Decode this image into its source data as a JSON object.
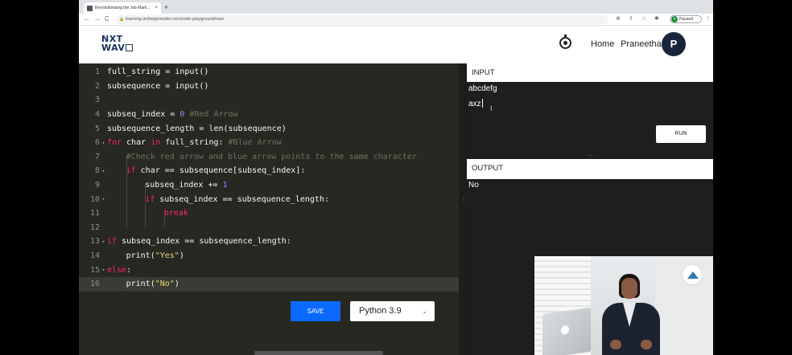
{
  "browser": {
    "tab_title": "Revolutionizing the Job Mark...",
    "tab_close": "×",
    "new_tab": "+",
    "nav_back": "←",
    "nav_forward": "→",
    "nav_reload": "C",
    "lock": "🔒",
    "url": "learning.onthegomodel.com/code-playground/new",
    "profile_initial": "V",
    "profile_status": "Paused"
  },
  "header": {
    "logo_line1": "NXT",
    "logo_line2": "WAV",
    "nav_home": "Home",
    "nav_user": "Praneetha",
    "avatar_initial": "P"
  },
  "editor": {
    "lines": [
      {
        "n": "1",
        "fold": "",
        "active": false
      },
      {
        "n": "2",
        "fold": "",
        "active": false
      },
      {
        "n": "3",
        "fold": "",
        "active": false
      },
      {
        "n": "4",
        "fold": "",
        "active": false
      },
      {
        "n": "5",
        "fold": "",
        "active": false
      },
      {
        "n": "6",
        "fold": "▾",
        "active": false
      },
      {
        "n": "7",
        "fold": "",
        "active": false
      },
      {
        "n": "8",
        "fold": "▾",
        "active": false
      },
      {
        "n": "9",
        "fold": "",
        "active": false
      },
      {
        "n": "10",
        "fold": "▾",
        "active": false
      },
      {
        "n": "11",
        "fold": "",
        "active": false
      },
      {
        "n": "12",
        "fold": "",
        "active": false
      },
      {
        "n": "13",
        "fold": "▾",
        "active": false
      },
      {
        "n": "14",
        "fold": "",
        "active": false
      },
      {
        "n": "15",
        "fold": "▾",
        "active": false
      },
      {
        "n": "16",
        "fold": "",
        "active": true
      }
    ],
    "code": {
      "l1": "full_string = input()",
      "l2": "subsequence = input()",
      "l4a": "subseq_index = ",
      "l4b": "0",
      "l4c": " #Red Arrow",
      "l5": "subsequence_length = len(subsequence)",
      "l6a": "for",
      "l6b": " char ",
      "l6c": "in",
      "l6d": " full_string: ",
      "l6e": "#Blue Arrow",
      "l7": "#Check red arrow and blue arrow points to the same character",
      "l8a": "if",
      "l8b": " char == subsequence[subseq_index]:",
      "l9a": "subseq_index += ",
      "l9b": "1",
      "l10a": "if",
      "l10b": " subseq_index == subsequence_length:",
      "l11": "break",
      "l13a": "if",
      "l13b": " subseq_index == subsequence_length:",
      "l14a": "print(",
      "l14b": "\"Yes\"",
      "l14c": ")",
      "l15a": "else",
      "l15b": ":",
      "l16a": "print(",
      "l16b": "\"No\"",
      "l16c": ")"
    },
    "save_label": "SAVE",
    "language": "Python 3.9",
    "language_chevron": "⌄",
    "split_dots": "⋮"
  },
  "input_pane": {
    "label": "INPUT",
    "lines": [
      "abcdefg",
      "axz"
    ],
    "ibeam": "I",
    "run_label": "RUN",
    "divider": "....."
  },
  "output_pane": {
    "label": "OUTPUT",
    "text": "No"
  },
  "colors": {
    "editor_bg": "#272822",
    "keyword": "#f92672",
    "number": "#ae81ff",
    "string": "#e6db74",
    "comment": "#75715e",
    "save_button": "#0b69ff",
    "avatar": "#17243c"
  }
}
